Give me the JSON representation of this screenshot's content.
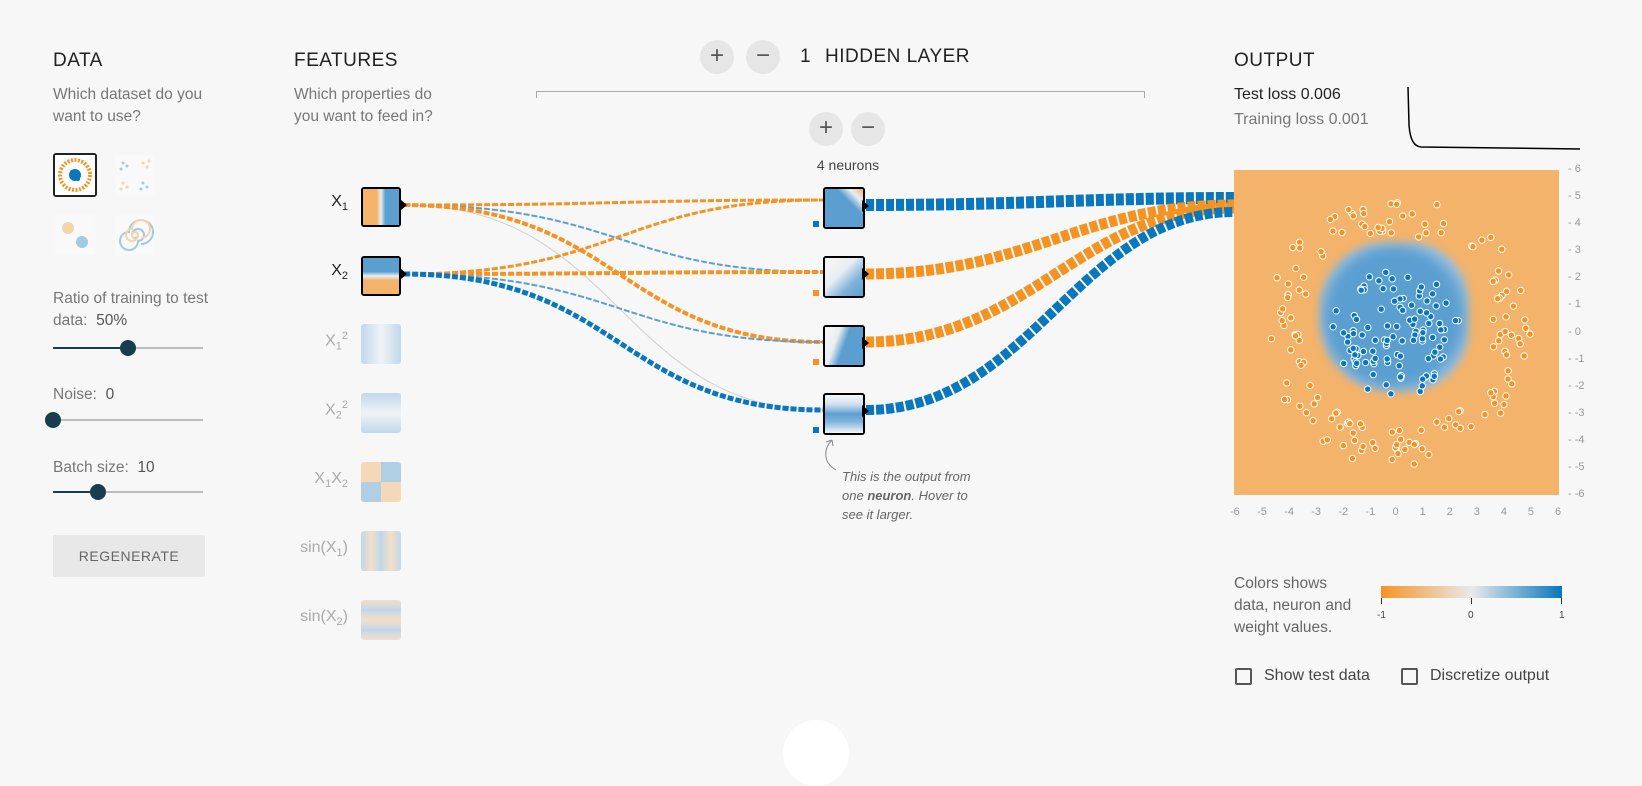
{
  "data_panel": {
    "title": "DATA",
    "question": "Which dataset do you want to use?",
    "datasets": [
      {
        "name": "circle",
        "selected": true
      },
      {
        "name": "xor",
        "selected": false
      },
      {
        "name": "gaussian",
        "selected": false
      },
      {
        "name": "spiral",
        "selected": false
      }
    ],
    "ratio_label": "Ratio of training to test data:",
    "ratio_value": "50%",
    "ratio_fraction": 0.5,
    "noise_label": "Noise:",
    "noise_value": "0",
    "noise_fraction": 0,
    "batch_label": "Batch size:",
    "batch_value": "10",
    "batch_fraction": 0.3,
    "regenerate_label": "REGENERATE"
  },
  "features_panel": {
    "title": "FEATURES",
    "question": "Which properties do you want to feed in?",
    "features": [
      {
        "base": "X",
        "sub": "1",
        "sup": "",
        "active": true
      },
      {
        "base": "X",
        "sub": "2",
        "sup": "",
        "active": true
      },
      {
        "base": "X",
        "sub": "1",
        "sup": "2",
        "active": false
      },
      {
        "base": "X",
        "sub": "2",
        "sup": "2",
        "active": false
      },
      {
        "base": "X",
        "sub": "1",
        "base2": "X",
        "sub2": "2",
        "active": false
      },
      {
        "base": "sin(X",
        "sub": "1",
        "tail": ")",
        "active": false
      },
      {
        "base": "sin(X",
        "sub": "2",
        "tail": ")",
        "active": false
      }
    ]
  },
  "network": {
    "layer_count": "1",
    "layer_label": "HIDDEN LAYER",
    "add_layer_symbol": "+",
    "remove_layer_symbol": "−",
    "add_neuron_symbol": "+",
    "remove_neuron_symbol": "−",
    "neurons_label": "4 neurons",
    "note_line1": "This is the output from one ",
    "note_bold": "neuron",
    "note_line2": ". Hover to see it larger."
  },
  "output_panel": {
    "title": "OUTPUT",
    "test_loss_label": "Test loss",
    "test_loss_value": "0.006",
    "training_loss_label": "Training loss",
    "training_loss_value": "0.001",
    "y_ticks": [
      "6",
      "5",
      "4",
      "3",
      "2",
      "1",
      "0",
      "-1",
      "-2",
      "-3",
      "-4",
      "-5",
      "-6"
    ],
    "x_ticks": [
      "-6",
      "-5",
      "-4",
      "-3",
      "-2",
      "-1",
      "0",
      "1",
      "2",
      "3",
      "4",
      "5",
      "6"
    ],
    "legend_text": "Colors shows data, neuron and weight values.",
    "legend_ticks": [
      "-1",
      "0",
      "1"
    ],
    "show_test_label": "Show test data",
    "discretize_label": "Discretize output"
  },
  "colors": {
    "orange": "#f59322",
    "blue": "#0877bd",
    "light_orange": "#f4b36a",
    "light_blue": "#5b9fd1"
  }
}
